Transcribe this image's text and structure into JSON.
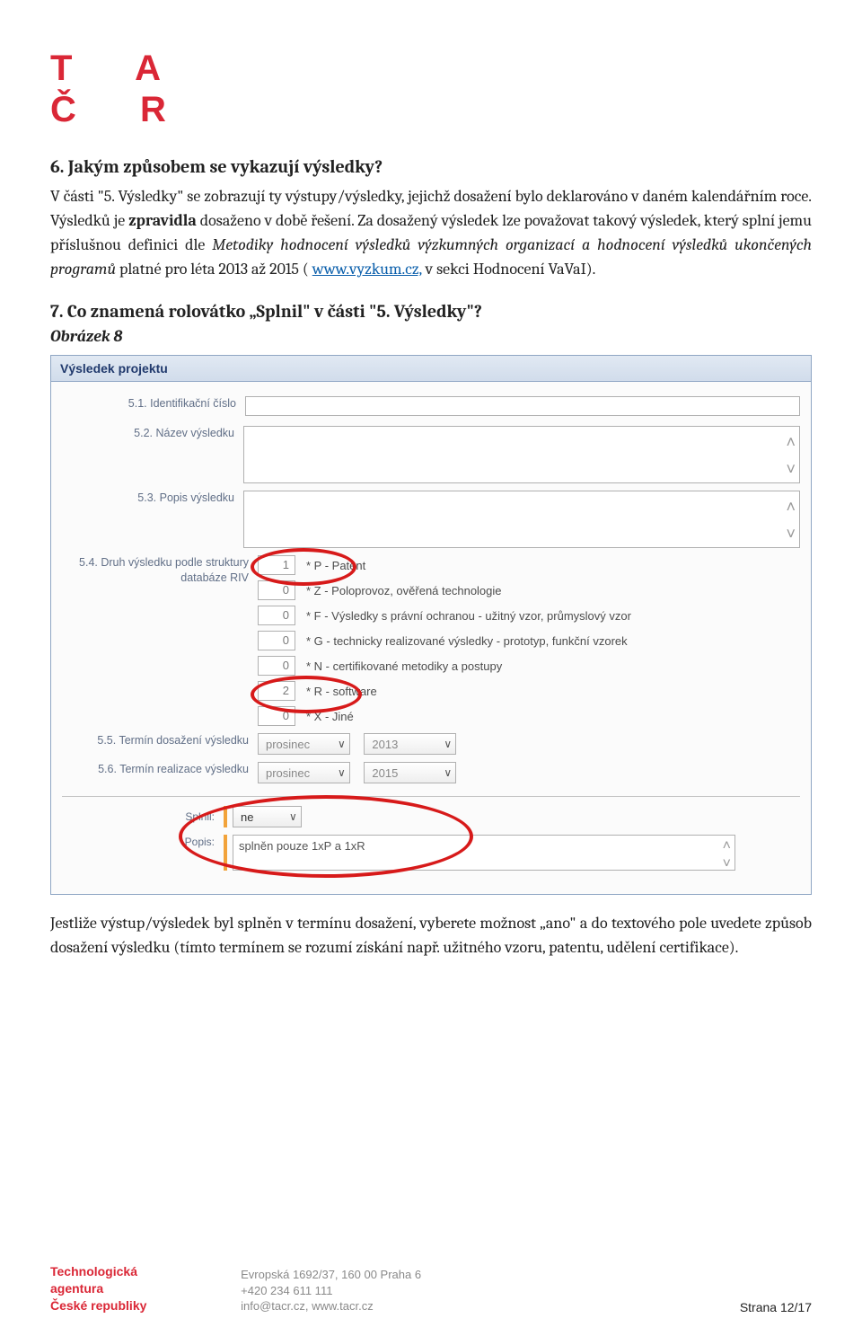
{
  "logo": {
    "row1": "T A",
    "row2": "Č R"
  },
  "section6": {
    "heading": "6.  Jakým způsobem se vykazují výsledky?",
    "para1_pre": "V části \"5. Výsledky\" se zobrazují ty výstupy/výsledky, jejichž dosažení bylo deklarováno v daném kalendářním roce. Výsledků je ",
    "para1_bold": "zpravidla",
    "para1_post": " dosaženo v době řešení. Za dosažený výsledek lze považovat takový výsledek, který splní jemu příslušnou definici dle ",
    "para1_ital": "Metodiky hodnocení výsledků výzkumných organizací a hodnocení výsledků ukončených programů",
    "para1_tail_pre": " platné pro léta 2013 až 2015 (",
    "para1_link_text": "www.vyzkum.cz,",
    "para1_tail_post": " v sekci Hodnocení VaVaI)."
  },
  "section7": {
    "heading": "7.  Co znamená rolovátko „Splnil\" v části \"5. Výsledky\"?",
    "fig_label": "Obrázek 8"
  },
  "panel": {
    "title": "Výsledek projektu",
    "fields": {
      "f51": "5.1. Identifikační číslo",
      "f52": "5.2. Název výsledku",
      "f53": "5.3. Popis výsledku",
      "f54": "5.4. Druh výsledku podle struktury databáze RIV",
      "f55": "5.5. Termín dosažení výsledku",
      "f56": "5.6. Termín realizace výsledku",
      "splnil_label": "Splnil:",
      "popis_label": "Popis:"
    },
    "riv_items": [
      {
        "count": "1",
        "text": "* P - Patent"
      },
      {
        "count": "0",
        "text": "* Z - Poloprovoz, ověřená technologie"
      },
      {
        "count": "0",
        "text": "* F - Výsledky s právní ochranou - užitný vzor, průmyslový vzor"
      },
      {
        "count": "0",
        "text": "* G - technicky realizované výsledky - prototyp, funkční vzorek"
      },
      {
        "count": "0",
        "text": "* N - certifikované metodiky a postupy"
      },
      {
        "count": "2",
        "text": "* R - software"
      },
      {
        "count": "0",
        "text": "* X - Jiné"
      }
    ],
    "term_dosazeni": {
      "month": "prosinec",
      "year": "2013"
    },
    "term_realizace": {
      "month": "prosinec",
      "year": "2015"
    },
    "splnil_value": "ne",
    "popis_value": "splněn pouze 1xP a 1xR"
  },
  "after_panel": "Jestliže výstup/výsledek byl splněn v termínu dosažení, vyberete možnost „ano\" a do textového pole uvedete způsob dosažení výsledku (tímto termínem se rozumí získání např. užitného vzoru, patentu, udělení certifikace).",
  "footer": {
    "org1": "Technologická",
    "org2": "agentura",
    "org3": "České republiky",
    "addr": "Evropská 1692/37, 160 00 Praha 6",
    "phone": "+420 234 611 111",
    "contact": "info@tacr.cz, www.tacr.cz",
    "page": "Strana 12/17"
  }
}
